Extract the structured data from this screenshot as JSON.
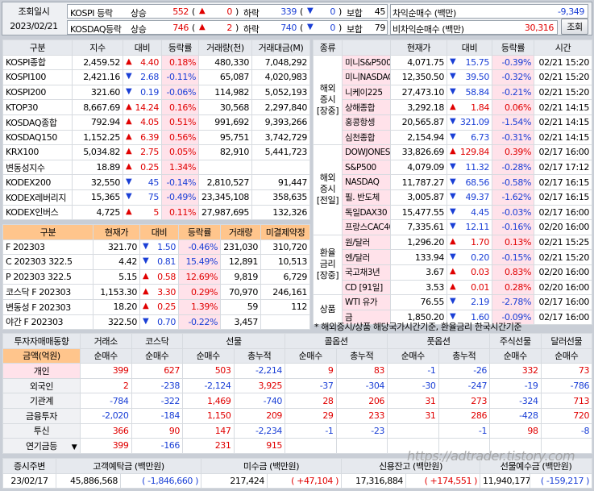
{
  "top": {
    "label_time": "조회일시",
    "date": "2023/02/21",
    "rows": [
      {
        "name": "KOSPI 등락",
        "up_label": "상승",
        "up": "552",
        "up_ch": "0",
        "dn_label": "하락",
        "dn": "339",
        "dn_ch": "0",
        "flat_label": "보합",
        "flat": "45"
      },
      {
        "name": "KOSDAQ등락",
        "up_label": "상승",
        "up": "746",
        "up_ch": "2",
        "dn_label": "하락",
        "dn": "740",
        "dn_ch": "0",
        "flat_label": "보합",
        "flat": "79"
      }
    ],
    "net": [
      {
        "label": "차익순매수 (백만)",
        "value": "-9,349"
      },
      {
        "label": "비차익순매수 (백만)",
        "value": "30,316"
      }
    ],
    "query_button": "조회"
  },
  "index": {
    "headers": [
      "구분",
      "지수",
      "대비",
      "등락률",
      "거래량(천)",
      "거래대금(M)"
    ],
    "rows": [
      [
        "KOSPI종합",
        "2,459.52",
        "4.40",
        "0.18%",
        "480,330",
        "7,048,292",
        "u"
      ],
      [
        "KOSPI100",
        "2,421.16",
        "2.68",
        "-0.11%",
        "65,087",
        "4,020,983",
        "d"
      ],
      [
        "KOSPI200",
        "321.60",
        "0.19",
        "-0.06%",
        "114,982",
        "5,052,193",
        "d"
      ],
      [
        "KTOP30",
        "8,667.69",
        "14.24",
        "0.16%",
        "30,568",
        "2,297,840",
        "u"
      ],
      [
        "KOSDAQ종합",
        "792.94",
        "4.05",
        "0.51%",
        "991,692",
        "9,393,266",
        "u"
      ],
      [
        "KOSDAQ150",
        "1,152.25",
        "6.39",
        "0.56%",
        "95,751",
        "3,742,729",
        "u"
      ],
      [
        "KRX100",
        "5,034.82",
        "2.75",
        "0.05%",
        "82,910",
        "5,441,723",
        "u"
      ],
      [
        "변동성지수",
        "18.89",
        "0.25",
        "1.34%",
        "",
        "",
        "u"
      ],
      [
        "KODEX200",
        "32,550",
        "45",
        "-0.14%",
        "2,810,527",
        "91,447",
        "d"
      ],
      [
        "KODEX레버리지",
        "15,365",
        "75",
        "-0.49%",
        "23,345,108",
        "358,635",
        "d"
      ],
      [
        "KODEX인버스",
        "4,725",
        "5",
        "0.11%",
        "27,987,695",
        "132,326",
        "u"
      ]
    ]
  },
  "futures": {
    "headers": [
      "구분",
      "현재가",
      "대비",
      "등락률",
      "거래량",
      "미결제약정"
    ],
    "rows": [
      [
        "F 202303",
        "321.70",
        "1.50",
        "-0.46%",
        "231,030",
        "310,720",
        "d"
      ],
      [
        "C 202303 322.5",
        "4.42",
        "0.81",
        "15.49%",
        "12,891",
        "10,513",
        "d"
      ],
      [
        "P 202303 322.5",
        "5.15",
        "0.58",
        "12.69%",
        "9,819",
        "6,729",
        "u"
      ],
      [
        "코스닥 F 202303",
        "1,153.30",
        "3.30",
        "0.29%",
        "70,970",
        "246,161",
        "u"
      ],
      [
        "변동성 F 202303",
        "18.20",
        "0.25",
        "1.39%",
        "59",
        "112",
        "u"
      ],
      [
        "야간 F 202303",
        "322.50",
        "0.70",
        "-0.22%",
        "3,457",
        "",
        "d"
      ]
    ]
  },
  "global": {
    "headers": [
      "종류",
      "현재가",
      "대비",
      "등락률",
      "시간"
    ],
    "groups": [
      {
        "label": "해외\n증시\n[장중]",
        "rows": [
          [
            "미니S&P500",
            "4,071.75",
            "15.75",
            "-0.39%",
            "02/21 15:20",
            "d"
          ],
          [
            "미니NASDAQ",
            "12,350.50",
            "39.50",
            "-0.32%",
            "02/21 15:20",
            "d"
          ],
          [
            "니케이225",
            "27,473.10",
            "58.84",
            "-0.21%",
            "02/21 15:20",
            "d"
          ],
          [
            "상해종합",
            "3,292.18",
            "1.84",
            "0.06%",
            "02/21 14:15",
            "u"
          ],
          [
            "홍콩항셍",
            "20,565.87",
            "321.09",
            "-1.54%",
            "02/21 14:15",
            "d"
          ],
          [
            "심천종합",
            "2,154.94",
            "6.73",
            "-0.31%",
            "02/21 14:15",
            "d"
          ]
        ]
      },
      {
        "label": "해외\n증시\n[전일]",
        "rows": [
          [
            "DOWJONES",
            "33,826.69",
            "129.84",
            "0.39%",
            "02/17 16:00",
            "u"
          ],
          [
            "S&P500",
            "4,079.09",
            "11.32",
            "-0.28%",
            "02/17 17:12",
            "d"
          ],
          [
            "NASDAQ",
            "11,787.27",
            "68.56",
            "-0.58%",
            "02/17 16:15",
            "d"
          ],
          [
            "필. 반도체",
            "3,005.87",
            "49.37",
            "-1.62%",
            "02/17 16:15",
            "d"
          ],
          [
            "독일DAX30",
            "15,477.55",
            "4.45",
            "-0.03%",
            "02/17 16:00",
            "d"
          ],
          [
            "프랑스CAC40",
            "7,335.61",
            "12.11",
            "-0.16%",
            "02/20 16:00",
            "d"
          ]
        ]
      },
      {
        "label": "환율\n금리\n[장중]",
        "rows": [
          [
            "원/달러",
            "1,296.20",
            "1.70",
            "0.13%",
            "02/21 15:25",
            "u"
          ],
          [
            "엔/달러",
            "133.94",
            "0.20",
            "-0.15%",
            "02/21 15:20",
            "d"
          ],
          [
            "국고채3년",
            "3.67",
            "0.03",
            "0.83%",
            "02/20 16:00",
            "u"
          ],
          [
            "CD [91일]",
            "3.53",
            "0.01",
            "0.28%",
            "02/20 16:00",
            "u"
          ]
        ]
      },
      {
        "label": "상품",
        "rows": [
          [
            "WTI 유가",
            "76.55",
            "2.19",
            "-2.78%",
            "02/17 16:00",
            "d"
          ],
          [
            "금",
            "1,850.20",
            "1.60",
            "-0.09%",
            "02/17 16:00",
            "d"
          ]
        ]
      }
    ],
    "note": "* 해외증시/상품 해당국가시간기준, 환율금리 한국시간기준"
  },
  "investor": {
    "corner": "투자자매매동향",
    "groups": [
      "거래소",
      "코스닥",
      "선물",
      "콜옵션",
      "풋옵션",
      "주식선물",
      "달러선물"
    ],
    "unit": "금액(억원)",
    "sub": [
      "순매수",
      "순매수",
      "순매수",
      "총누적",
      "순매수",
      "총누적",
      "순매수",
      "총누적",
      "순매수",
      "순매수"
    ],
    "rows": [
      [
        "개인",
        "399",
        "627",
        "503",
        "-2,214",
        "9",
        "83",
        "-1",
        "-26",
        "332",
        "73"
      ],
      [
        "외국인",
        "2",
        "-238",
        "-2,124",
        "3,925",
        "-37",
        "-304",
        "-30",
        "-247",
        "-19",
        "-786"
      ],
      [
        "기관계",
        "-784",
        "-322",
        "1,469",
        "-740",
        "28",
        "206",
        "31",
        "273",
        "-324",
        "713"
      ],
      [
        "금융투자",
        "-2,020",
        "-184",
        "1,150",
        "209",
        "29",
        "233",
        "31",
        "286",
        "-428",
        "720"
      ],
      [
        "투신",
        "366",
        "90",
        "147",
        "-2,234",
        "-1",
        "-23",
        "",
        "-1",
        "98",
        "-8"
      ],
      [
        "연기금등",
        "399",
        "-166",
        "231",
        "915",
        "",
        "",
        "",
        "",
        "",
        ""
      ]
    ]
  },
  "bottom": {
    "headers": [
      "증시주변",
      "고객예탁금 (백만원)",
      "미수금 (백만원)",
      "신용잔고 (백만원)",
      "선물예수금 (백만원)"
    ],
    "date": "23/02/17",
    "deposit": "45,886,568",
    "deposit_ch": "( -1,846,660 )",
    "unpaid": "217,424",
    "unpaid_ch": "( +47,104 )",
    "credit": "17,316,884",
    "credit_ch": "( +174,551 )",
    "fut": "11,940,177",
    "fut_ch": "( -159,217 )"
  },
  "watermark": "https://adtrader.tistory.com"
}
